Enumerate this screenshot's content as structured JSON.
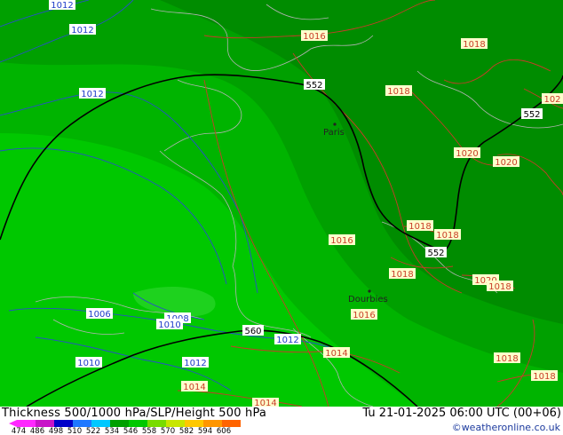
{
  "map": {
    "isobars": [
      {
        "label": "1012",
        "color": "blue"
      },
      {
        "label": "1012",
        "color": "blue"
      },
      {
        "label": "1012",
        "color": "blue"
      },
      {
        "label": "1016",
        "color": "red"
      },
      {
        "label": "1018",
        "color": "red"
      },
      {
        "label": "1018",
        "color": "red"
      },
      {
        "label": "1020",
        "color": "red"
      },
      {
        "label": "1020",
        "color": "red"
      },
      {
        "label": "1018",
        "color": "red"
      },
      {
        "label": "1018",
        "color": "red"
      },
      {
        "label": "1016",
        "color": "red"
      },
      {
        "label": "1018",
        "color": "red"
      },
      {
        "label": "1020",
        "color": "red"
      },
      {
        "label": "1018",
        "color": "red"
      },
      {
        "label": "1016",
        "color": "red"
      },
      {
        "label": "1014",
        "color": "red"
      },
      {
        "label": "1014",
        "color": "red"
      },
      {
        "label": "1014",
        "color": "red"
      },
      {
        "label": "1018",
        "color": "red"
      },
      {
        "label": "1018",
        "color": "red"
      },
      {
        "label": "102",
        "color": "red"
      },
      {
        "label": "1006",
        "color": "blue"
      },
      {
        "label": "1008",
        "color": "blue"
      },
      {
        "label": "1010",
        "color": "blue"
      },
      {
        "label": "1012",
        "color": "blue"
      },
      {
        "label": "1010",
        "color": "blue"
      },
      {
        "label": "1012",
        "color": "blue"
      }
    ],
    "height_labels": [
      "552",
      "552",
      "552",
      "560"
    ],
    "cities": [
      "Paris",
      "Dourbies"
    ]
  },
  "footer": {
    "title": "Thickness 500/1000 hPa/SLP/Height 500 hPa",
    "time": "Tu 21-01-2025 06:00 UTC (00+06)",
    "credit": "©weatheronline.co.uk"
  },
  "legend": {
    "ticks": [
      "474",
      "486",
      "498",
      "510",
      "522",
      "534",
      "546",
      "558",
      "570",
      "582",
      "594",
      "606"
    ],
    "colors": [
      "#ff28ff",
      "#c814c8",
      "#0000c8",
      "#1e78ff",
      "#00c8ff",
      "#00a000",
      "#00c800",
      "#78dc00",
      "#c8e600",
      "#ffc800",
      "#ff9600",
      "#ff6400"
    ]
  },
  "colors": {
    "isobar_red": "#c83c28",
    "isobar_blue": "#2850c8",
    "height_line": "#000000",
    "thickness_dark": "#008c00",
    "thickness_mid": "#00a000",
    "thickness_light": "#00b400",
    "thickness_lightest": "#00c800"
  }
}
